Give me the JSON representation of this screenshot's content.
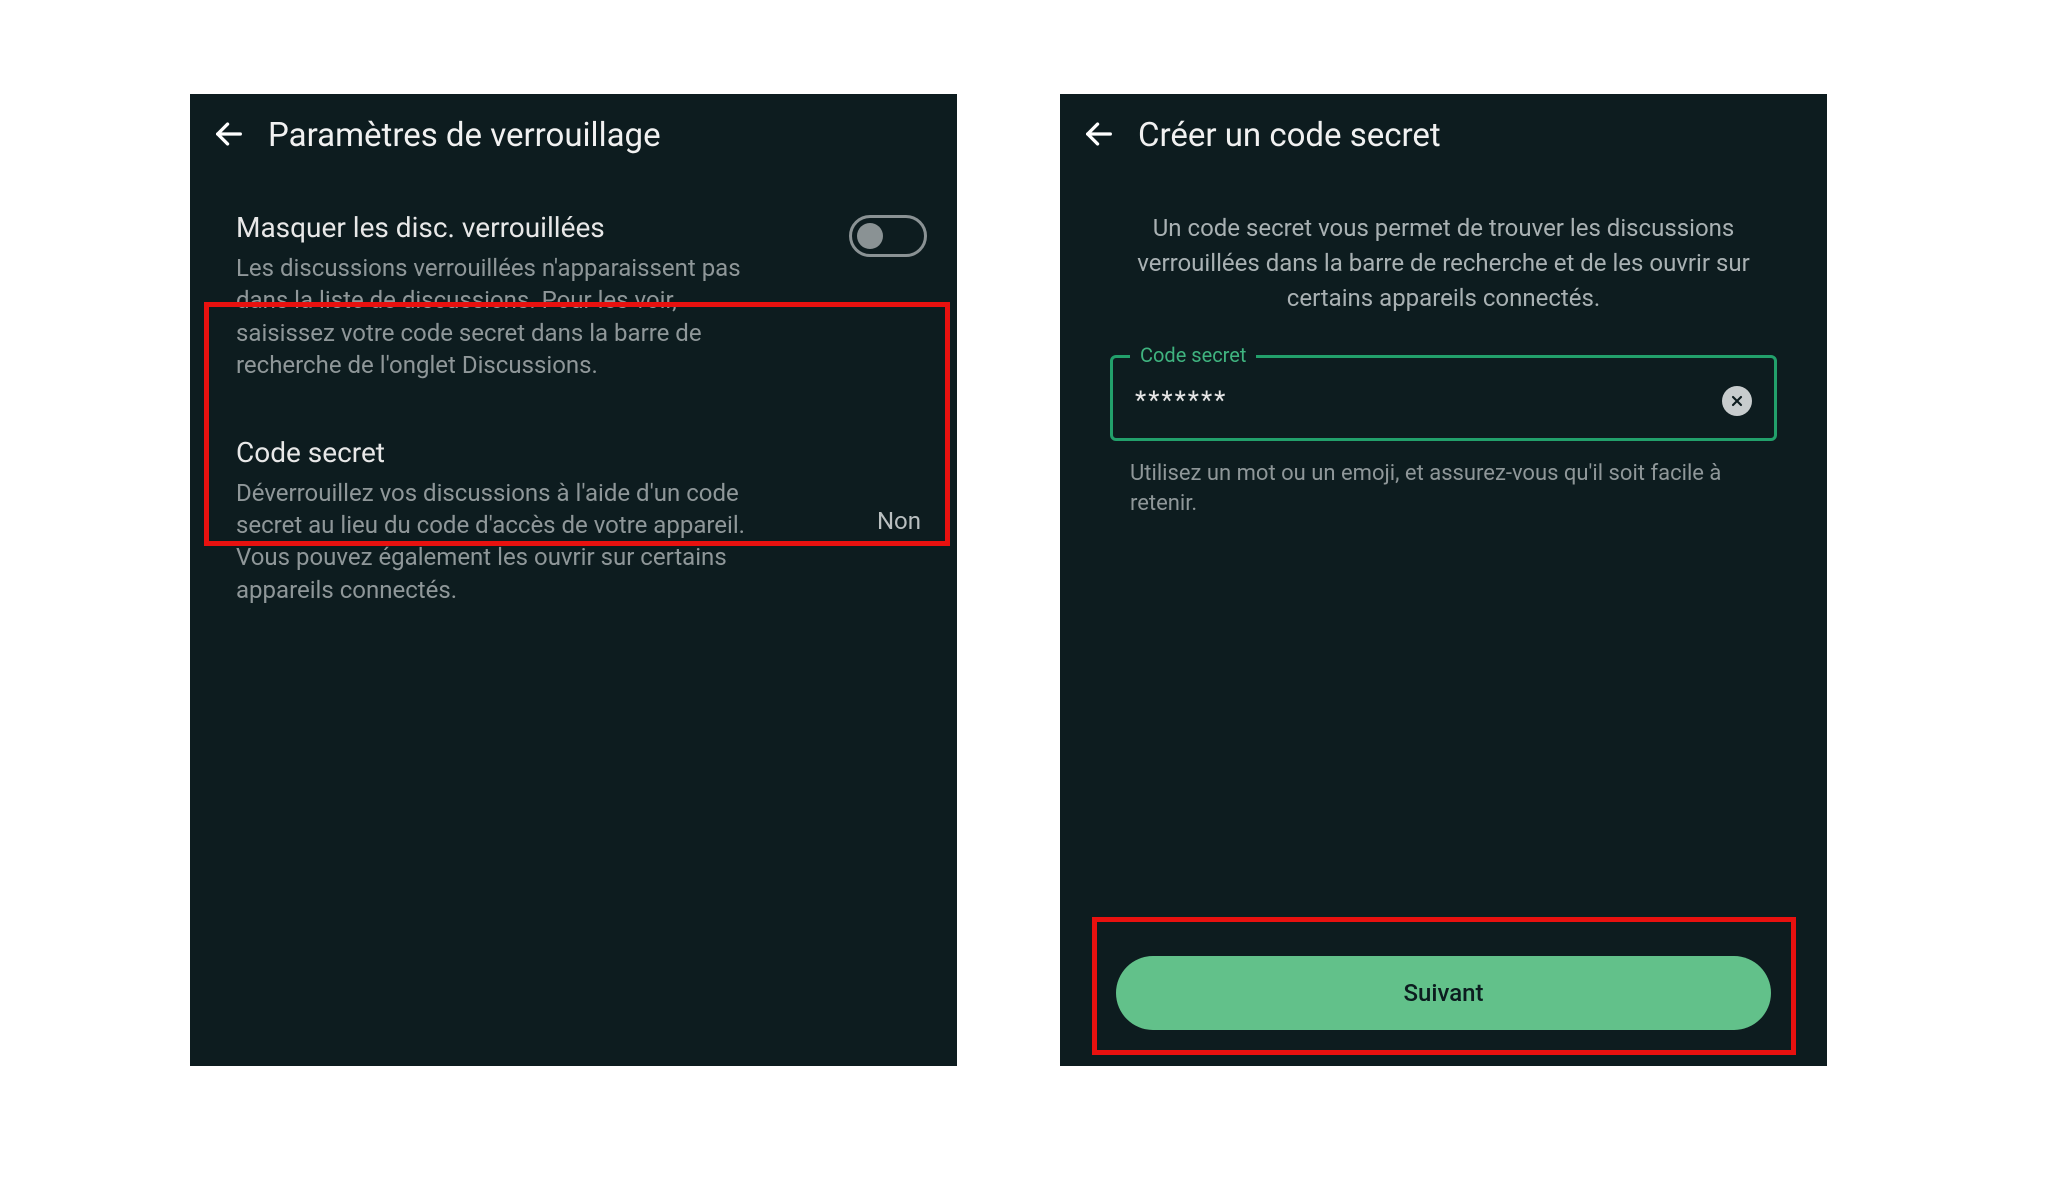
{
  "left": {
    "title": "Paramètres de verrouillage",
    "hide": {
      "title": "Masquer les disc. verrouillées",
      "desc": "Les discussions verrouillées n'apparaissent pas dans la liste de discussions. Pour les voir, saisissez votre code secret dans la barre de recherche de l'onglet Discussions."
    },
    "code": {
      "title": "Code secret",
      "desc": "Déverrouillez vos discussions à l'aide d'un code secret au lieu du code d'accès de votre appareil. Vous pouvez également les ouvrir sur certains appareils connectés.",
      "value": "Non"
    }
  },
  "right": {
    "title": "Créer un code secret",
    "info": "Un code secret vous permet de trouver les discussions verrouillées dans la barre de recherche et de les ouvrir sur certains appareils connectés.",
    "input": {
      "label": "Code secret",
      "value": "*******",
      "helper": "Utilisez un mot ou un emoji, et assurez-vous qu'il soit facile à retenir."
    },
    "next": "Suivant"
  }
}
